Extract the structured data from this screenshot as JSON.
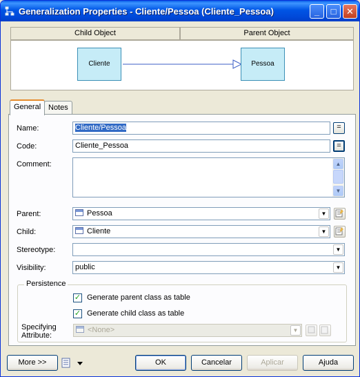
{
  "window": {
    "title": "Generalization Properties - Cliente/Pessoa (Cliente_Pessoa)",
    "controls": {
      "minimize": "_",
      "maximize": "□",
      "close": "✕"
    }
  },
  "header": {
    "child_object_label": "Child Object",
    "parent_object_label": "Parent Object"
  },
  "diagram": {
    "child_entity": "Cliente",
    "parent_entity": "Pessoa"
  },
  "tabs": [
    {
      "label": "General",
      "active": true
    },
    {
      "label": "Notes",
      "active": false
    }
  ],
  "form": {
    "name": {
      "label": "Name:",
      "value": "Cliente/Pessoa"
    },
    "code": {
      "label": "Code:",
      "value": "Cliente_Pessoa"
    },
    "comment": {
      "label": "Comment:",
      "value": ""
    },
    "parent": {
      "label": "Parent:",
      "value": "Pessoa"
    },
    "child": {
      "label": "Child:",
      "value": "Cliente"
    },
    "stereotype": {
      "label": "Stereotype:",
      "value": ""
    },
    "visibility": {
      "label": "Visibility:",
      "value": "public"
    },
    "equals_glyph": "="
  },
  "persistence": {
    "title": "Persistence",
    "generate_parent": {
      "label": "Generate parent class as table",
      "checked": true
    },
    "generate_child": {
      "label": "Generate child class as table",
      "checked": true
    },
    "specifying_attribute_label_1": "Specifying",
    "specifying_attribute_label_2": "Attribute:",
    "specifying_attribute_value": "<None>"
  },
  "buttons": {
    "more": "More >>",
    "ok": "OK",
    "cancel": "Cancelar",
    "apply": "Aplicar",
    "help": "Ajuda"
  },
  "colors": {
    "titlebar": "#0055e5",
    "entity_fill": "#c6ecf7",
    "selection": "#316ac5"
  }
}
